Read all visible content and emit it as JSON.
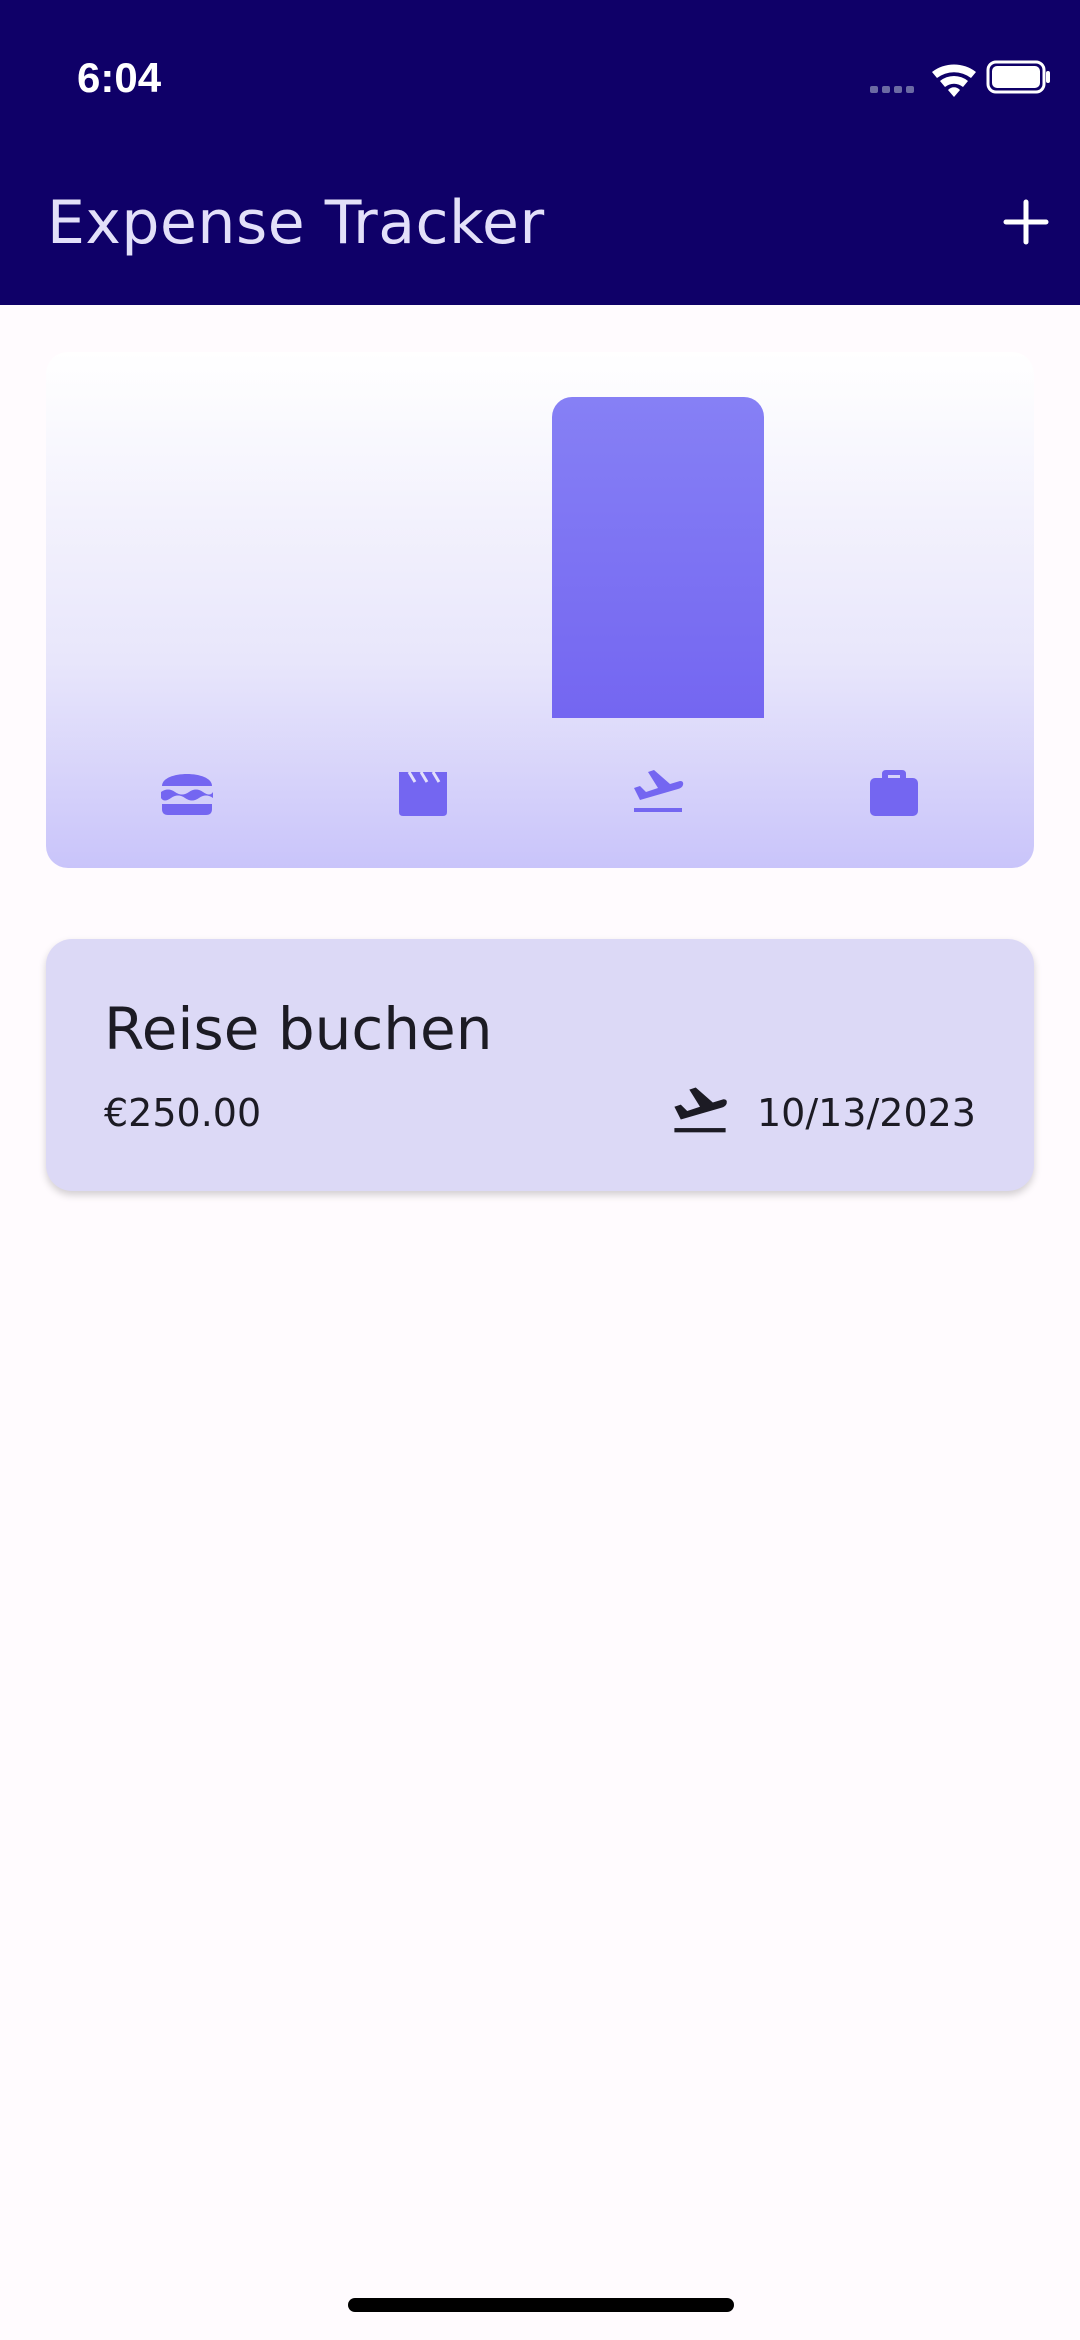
{
  "status_bar": {
    "time": "6:04"
  },
  "app_bar": {
    "title": "Expense Tracker",
    "add_icon": "plus-icon"
  },
  "colors": {
    "app_bar": "#0f0068",
    "title_text": "#e3e0f9",
    "accent": "#7466f1",
    "card": "#dcd9f6",
    "background": "#fffbfe"
  },
  "chart_data": {
    "type": "bar",
    "categories": [
      "food",
      "leisure",
      "travel",
      "work"
    ],
    "category_icons": [
      "burger-icon",
      "movie-clapper-icon",
      "flight-takeoff-icon",
      "work-briefcase-icon"
    ],
    "values": [
      0,
      0,
      250,
      0
    ],
    "ylim": [
      0,
      250
    ]
  },
  "expenses": [
    {
      "title": "Reise buchen",
      "amount": "€250.00",
      "category_icon": "flight-takeoff-icon",
      "date": "10/13/2023"
    }
  ]
}
